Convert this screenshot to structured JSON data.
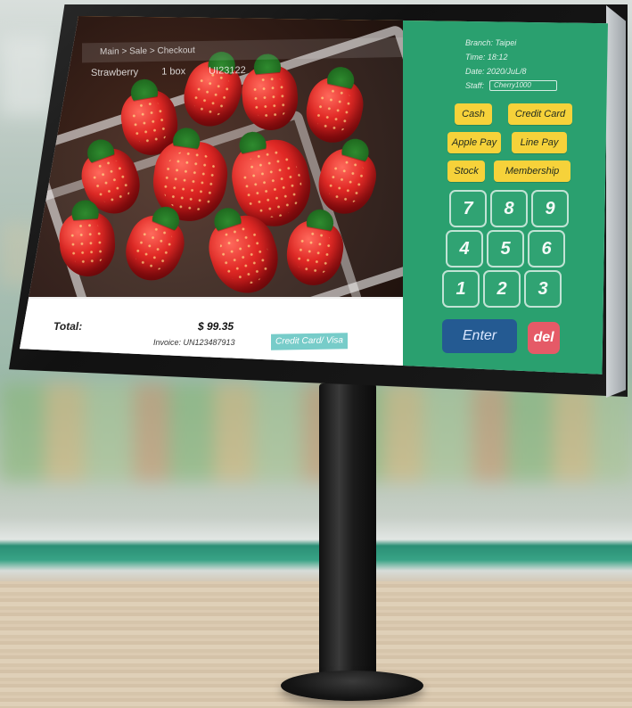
{
  "pos": {
    "breadcrumb": "Main > Sale > Checkout",
    "item": {
      "name": "Strawberry",
      "qty": "1 box",
      "code": "UI23122"
    },
    "summary": {
      "total_label": "Total:",
      "total_amount": "$ 99.35",
      "invoice": "Invoice: UN123487913",
      "payment_method": "Credit Card/ Visa"
    },
    "panel": {
      "branch": "Branch: Taipei",
      "time": "Time: 18:12",
      "date": "Date: 2020/JuL/8",
      "staff_label": "Staff:",
      "staff_value": "Cherry1000",
      "buttons": {
        "cash": "Cash",
        "credit_card": "Credit Card",
        "apple_pay": "Apple Pay",
        "line_pay": "Line Pay",
        "stock": "Stock",
        "membership": "Membership"
      },
      "keypad": [
        "7",
        "8",
        "9",
        "4",
        "5",
        "6",
        "1",
        "2",
        "3"
      ],
      "enter": "Enter",
      "del": "del"
    }
  },
  "colors": {
    "panel_green": "#2aa06f",
    "button_yellow": "#f6d23a",
    "enter_blue": "#245a92",
    "delete_red": "#e55a67",
    "accent_orange": "#f2a033",
    "chip_teal": "#69c7c4"
  }
}
